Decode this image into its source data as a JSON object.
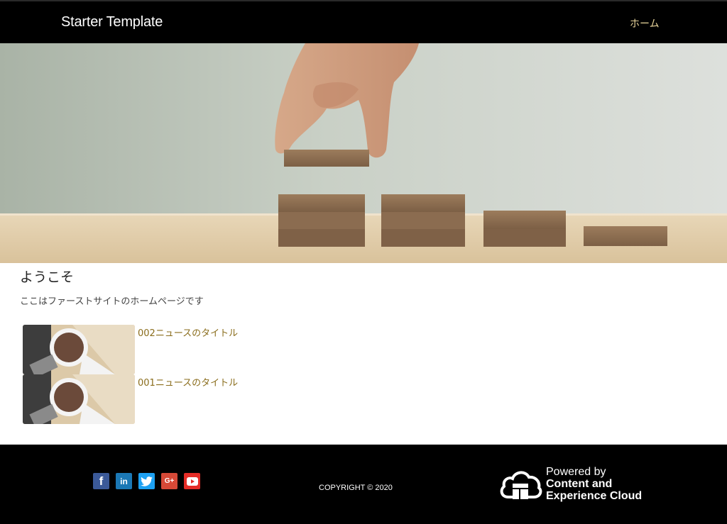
{
  "header": {
    "brand": "Starter Template",
    "nav_home": "ホーム"
  },
  "hero": {
    "image": "hand-placing-wooden-blocks-steps"
  },
  "main": {
    "title": "ようこそ",
    "description": "ここはファーストサイトのホームページです",
    "news": [
      {
        "title": "002ニュースのタイトル",
        "image": "coffee-cup-thumbnail"
      },
      {
        "title": "001ニュースのタイトル",
        "image": "coffee-cup-thumbnail"
      }
    ]
  },
  "footer": {
    "social": [
      {
        "name": "facebook",
        "glyph": "f"
      },
      {
        "name": "linkedin",
        "glyph": "in"
      },
      {
        "name": "twitter",
        "glyph": ""
      },
      {
        "name": "google-plus",
        "glyph": "G+"
      },
      {
        "name": "youtube",
        "glyph": ""
      }
    ],
    "copyright": "COPYRIGHT © 2020",
    "powered_line1": "Powered by",
    "powered_line2": "Content and",
    "powered_line3": "Experience Cloud"
  },
  "colors": {
    "navbar": "#000000",
    "nav_link": "#e8d49a",
    "news_link": "#8a6d1c",
    "facebook": "#3b5998",
    "linkedin": "#1b78b5",
    "twitter": "#1da1f2",
    "google_plus": "#d64937",
    "youtube": "#e52d27"
  }
}
